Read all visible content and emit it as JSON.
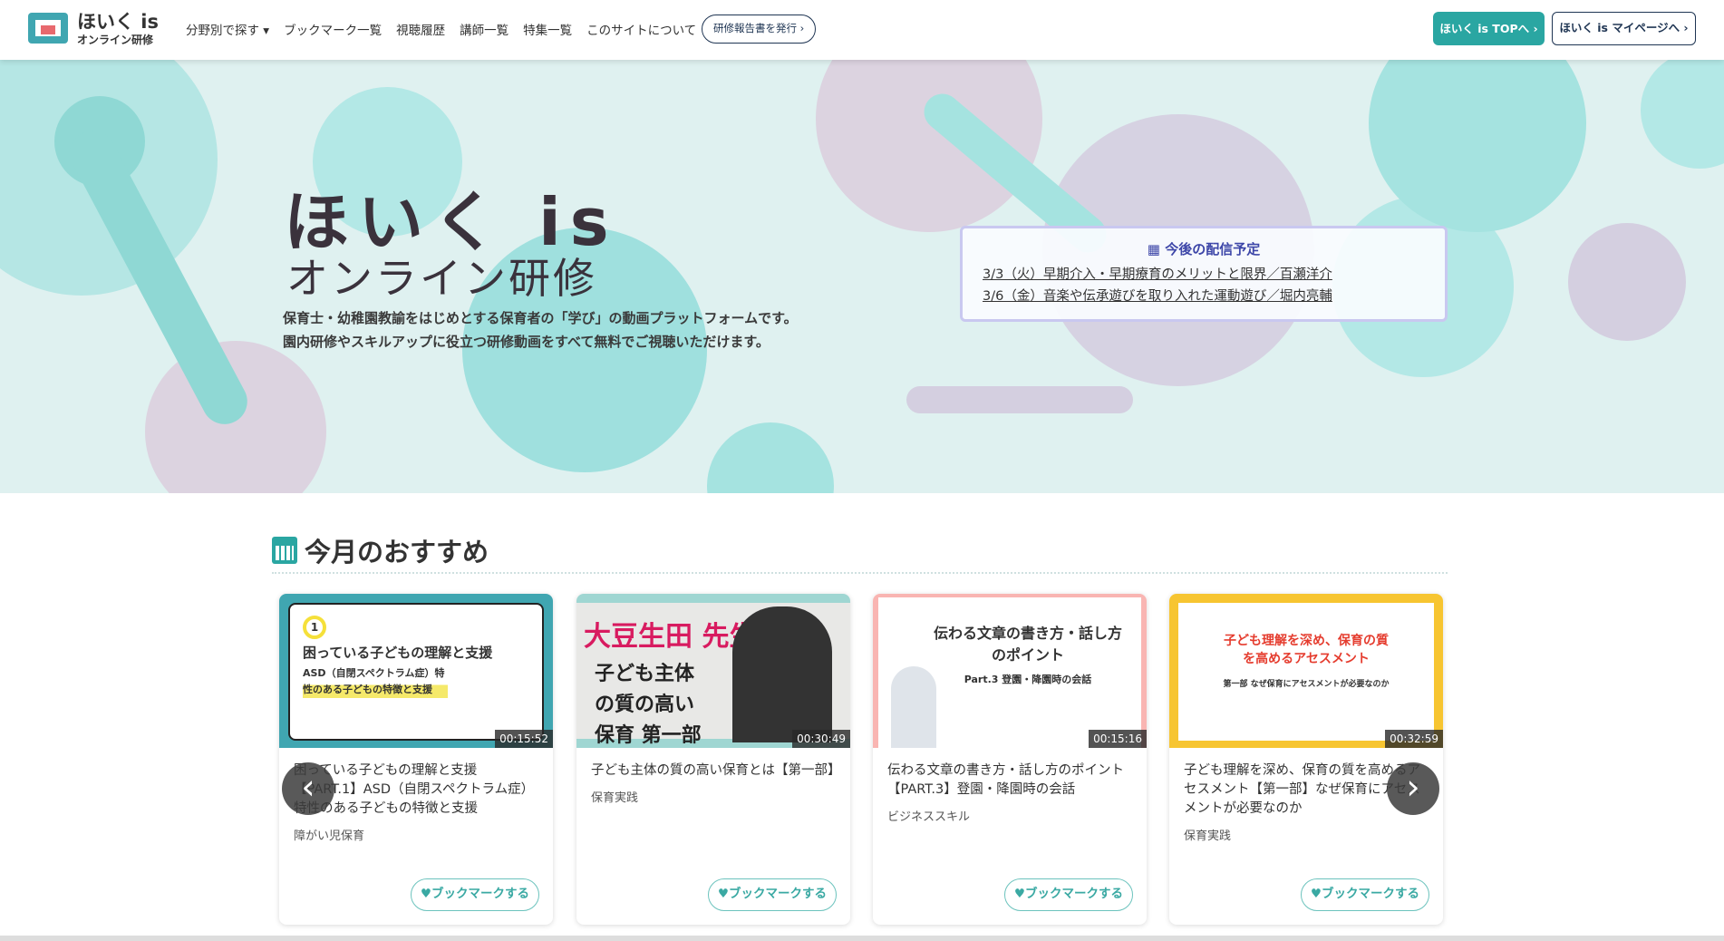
{
  "header": {
    "logo_main": "ほいく is",
    "logo_sub": "オンライン研修",
    "nav": [
      "分野別で探す ▾",
      "ブックマーク一覧",
      "視聴履歴",
      "講師一覧",
      "特集一覧",
      "このサイトについて"
    ],
    "report_button": "研修報告書を発行 ›",
    "top_button": "ほいく is TOPへ ›",
    "mypage_button": "ほいく is マイページへ ›"
  },
  "hero": {
    "title": "ほいく is",
    "subtitle": "オンライン研修",
    "desc1": "保育士・幼稚園教諭をはじめとする保育者の「学び」の動画プラットフォームです。",
    "desc2": "園内研修やスキルアップに役立つ研修動画をすべて無料でご視聴いただけます。"
  },
  "schedule": {
    "heading": "今後の配信予定",
    "items": [
      "3/3（火）早期介入・早期療育のメリットと限界／百瀬洋介",
      "3/6（金）音楽や伝承遊びを取り入れた運動遊び／堀内亮輔"
    ]
  },
  "section": {
    "title": "今月のおすすめ"
  },
  "cards": [
    {
      "thumb_title": "困っている子どもの理解と支援",
      "thumb_sub": "ASD（自閉スペクトラム症）特性のある子どもの特徴と支援",
      "thumb_num": "1",
      "duration": "00:15:52",
      "title": "困っている子どもの理解と支援【PART.1】ASD（自閉スペクトラム症）特性のある子どもの特徴と支援",
      "category": "障がい児保育",
      "bookmark": "ブックマークする"
    },
    {
      "thumb_title": "大豆生田 先生",
      "thumb_sub": "子ども主体の質の高い保育 第一部",
      "duration": "00:30:49",
      "title": "子ども主体の質の高い保育とは【第一部】",
      "category": "保育実践",
      "bookmark": "ブックマークする"
    },
    {
      "thumb_title": "伝わる文章の書き方・話し方のポイント",
      "thumb_sub": "Part.3 登園・降園時の会話",
      "duration": "00:15:16",
      "title": "伝わる文章の書き方・話し方のポイント【PART.3】登園・降園時の会話",
      "category": "ビジネススキル",
      "bookmark": "ブックマークする"
    },
    {
      "thumb_title": "子ども理解を深め、保育の質を高めるアセスメント",
      "thumb_sub": "第一部 なぜ保育にアセスメントが必要なのか",
      "duration": "00:32:59",
      "title": "子ども理解を深め、保育の質を高めるアセスメント【第一部】なぜ保育にアセスメントが必要なのか",
      "category": "保育実践",
      "bookmark": "ブックマークする"
    }
  ],
  "carousel": {
    "prev": "‹",
    "next": "›"
  }
}
